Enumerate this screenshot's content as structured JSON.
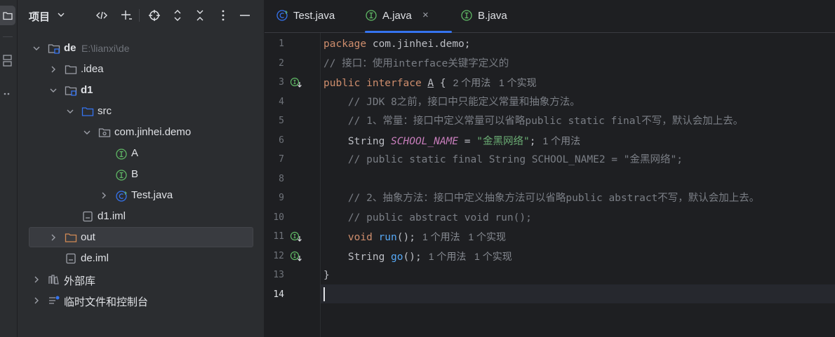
{
  "project": {
    "title": "项目",
    "tree": [
      {
        "label": "de",
        "hint": "E:\\lianxi\\de",
        "depth": 0,
        "expanded": true,
        "icon": "module-folder-icon",
        "bold": true
      },
      {
        "label": ".idea",
        "depth": 1,
        "expanded": false,
        "icon": "folder-icon"
      },
      {
        "label": "d1",
        "depth": 1,
        "expanded": true,
        "icon": "module-folder-icon",
        "bold": true
      },
      {
        "label": "src",
        "depth": 2,
        "expanded": true,
        "icon": "source-folder-icon"
      },
      {
        "label": "com.jinhei.demo",
        "depth": 3,
        "expanded": true,
        "icon": "package-icon"
      },
      {
        "label": "A",
        "depth": 4,
        "icon": "interface-icon"
      },
      {
        "label": "B",
        "depth": 4,
        "icon": "interface-icon"
      },
      {
        "label": "Test.java",
        "depth": 4,
        "expanded": false,
        "icon": "class-icon",
        "hasChevron": true
      },
      {
        "label": "d1.iml",
        "depth": 2,
        "icon": "iml-file-icon"
      },
      {
        "label": "out",
        "depth": 1,
        "expanded": false,
        "icon": "excluded-folder-icon",
        "selected": true
      },
      {
        "label": "de.iml",
        "depth": 1,
        "icon": "iml-file-icon"
      },
      {
        "label": "外部库",
        "depth": 0,
        "expanded": false,
        "icon": "library-icon"
      },
      {
        "label": "临时文件和控制台",
        "depth": 0,
        "expanded": false,
        "icon": "scratches-icon"
      }
    ]
  },
  "editor": {
    "tabs": [
      {
        "label": "Test.java",
        "icon": "class-icon",
        "active": false
      },
      {
        "label": "A.java",
        "icon": "interface-icon",
        "active": true,
        "close": "×"
      },
      {
        "label": "B.java",
        "icon": "interface-icon",
        "active": false
      }
    ],
    "current_line": 14,
    "lines": [
      {
        "n": "1",
        "tokens": [
          {
            "t": "package ",
            "c": "kw"
          },
          {
            "t": "com.jinhei.demo;"
          }
        ]
      },
      {
        "n": "2",
        "tokens": [
          {
            "t": "// 接口：使用interface关键字定义的",
            "c": "cm"
          }
        ]
      },
      {
        "n": "3",
        "gutter": "implemented-icon",
        "tokens": [
          {
            "t": "public interface ",
            "c": "kw"
          },
          {
            "t": "A",
            "c": "ul"
          },
          {
            "t": " {"
          },
          {
            "t": "2 个用法   1 个实现",
            "c": "inl"
          }
        ]
      },
      {
        "n": "4",
        "tokens": [
          {
            "t": "    // JDK 8之前，接口中只能定义常量和抽象方法。",
            "c": "cm"
          }
        ]
      },
      {
        "n": "5",
        "tokens": [
          {
            "t": "    // 1、常量：接口中定义常量可以省略public static final不写，默认会加上去。",
            "c": "cm"
          }
        ]
      },
      {
        "n": "6",
        "tokens": [
          {
            "t": "    String "
          },
          {
            "t": "SCHOOL_NAME",
            "c": "cn"
          },
          {
            "t": " = "
          },
          {
            "t": "\"金黑网络\"",
            "c": "st"
          },
          {
            "t": ";"
          },
          {
            "t": "1 个用法",
            "c": "inl"
          }
        ]
      },
      {
        "n": "7",
        "tokens": [
          {
            "t": "    // public static final String SCHOOL_NAME2 = \"金黑网络\";",
            "c": "cm"
          }
        ]
      },
      {
        "n": "8",
        "tokens": []
      },
      {
        "n": "9",
        "tokens": [
          {
            "t": "    // 2、抽象方法：接口中定义抽象方法可以省略public abstract不写，默认会加上去。",
            "c": "cm"
          }
        ]
      },
      {
        "n": "10",
        "tokens": [
          {
            "t": "    // public abstract void run();",
            "c": "cm"
          }
        ]
      },
      {
        "n": "11",
        "gutter": "implemented-icon",
        "tokens": [
          {
            "t": "    "
          },
          {
            "t": "void ",
            "c": "kw"
          },
          {
            "t": "run",
            "c": "fn"
          },
          {
            "t": "();"
          },
          {
            "t": "1 个用法   1 个实现",
            "c": "inl"
          }
        ]
      },
      {
        "n": "12",
        "gutter": "implemented-icon",
        "tokens": [
          {
            "t": "    String "
          },
          {
            "t": "go",
            "c": "fn"
          },
          {
            "t": "();"
          },
          {
            "t": "1 个用法   1 个实现",
            "c": "inl"
          }
        ]
      },
      {
        "n": "13",
        "tokens": [
          {
            "t": "}"
          }
        ]
      },
      {
        "n": "14",
        "tokens": []
      }
    ]
  },
  "colors": {
    "accent": "#3574f0",
    "interface_icon": "#5fb865",
    "folder_icon": "#9da0a8",
    "excluded_folder": "#d28a55"
  }
}
